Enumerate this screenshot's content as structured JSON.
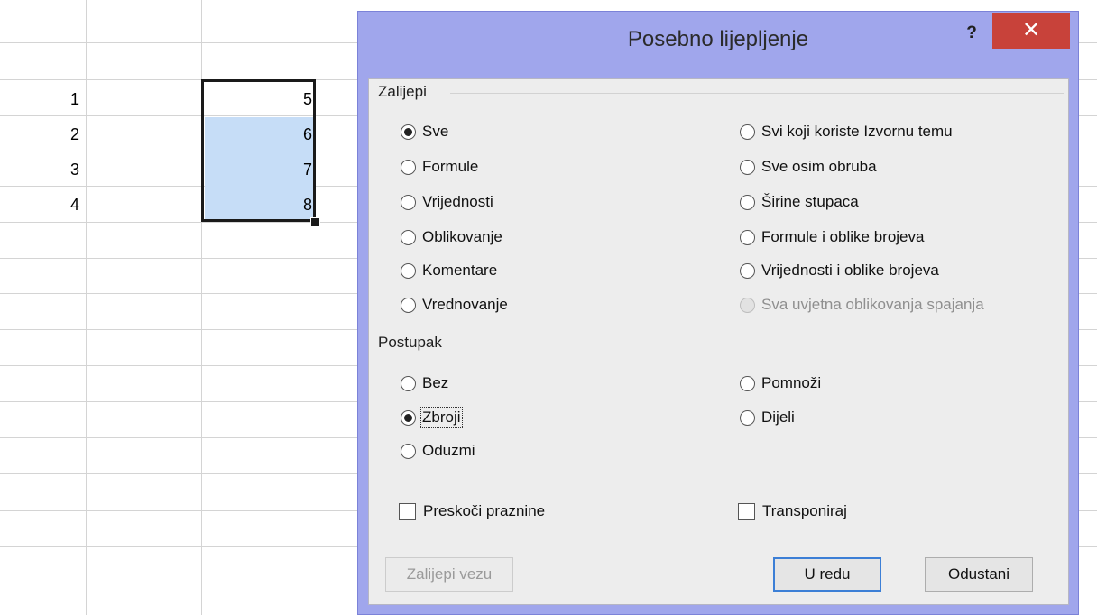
{
  "sheet": {
    "row_numbers": [
      "1",
      "2",
      "3",
      "4"
    ],
    "values": [
      "5",
      "6",
      "7",
      "8"
    ]
  },
  "dialog": {
    "title": "Posebno lijepljenje",
    "help_label": "?",
    "close_label": "✕",
    "paste_group": {
      "label": "Zalijepi",
      "left_options": [
        "Sve",
        "Formule",
        "Vrijednosti",
        "Oblikovanje",
        "Komentare",
        "Vrednovanje"
      ],
      "right_options": [
        "Svi koji koriste Izvornu temu",
        "Sve osim obruba",
        "Širine stupaca",
        "Formule i oblike brojeva",
        "Vrijednosti i oblike brojeva",
        "Sva uvjetna oblikovanja spajanja"
      ],
      "selected": "Sve",
      "disabled": [
        "Sva uvjetna oblikovanja spajanja"
      ]
    },
    "operation_group": {
      "label": "Postupak",
      "left_options": [
        "Bez",
        "Zbroji",
        "Oduzmi"
      ],
      "right_options": [
        "Pomnoži",
        "Dijeli"
      ],
      "selected": "Zbroji"
    },
    "checkboxes": {
      "skip_blanks": "Preskoči praznine",
      "transpose": "Transponiraj"
    },
    "buttons": {
      "paste_link": "Zalijepi vezu",
      "ok": "U redu",
      "cancel": "Odustani"
    }
  }
}
